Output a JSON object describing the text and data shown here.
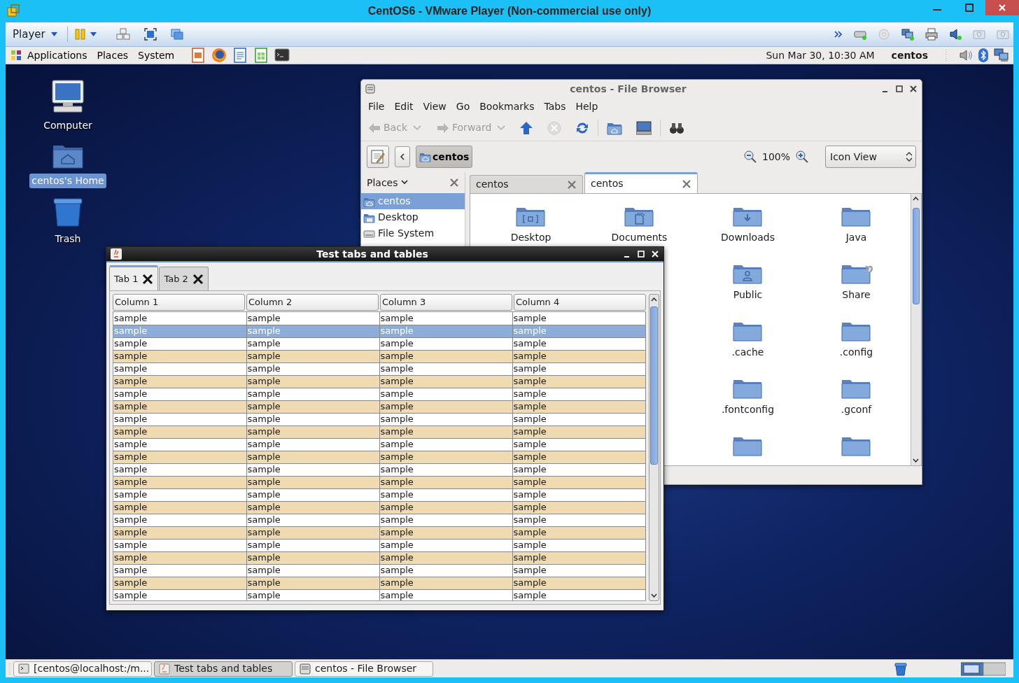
{
  "vm_window": {
    "title": "CentOS6 - VMware Player (Non-commercial use only)"
  },
  "vm_toolbar": {
    "player_menu": "Player"
  },
  "guest_panel": {
    "menus": [
      "Applications",
      "Places",
      "System"
    ],
    "clock": "Sun Mar 30, 10:30 AM",
    "user": "centos"
  },
  "desktop_icons": [
    {
      "label": "Computer",
      "kind": "computer",
      "selected": false
    },
    {
      "label": "centos's Home",
      "kind": "home",
      "selected": true
    },
    {
      "label": "Trash",
      "kind": "trash",
      "selected": false
    }
  ],
  "file_browser": {
    "title": "centos - File Browser",
    "menus": [
      "File",
      "Edit",
      "View",
      "Go",
      "Bookmarks",
      "Tabs",
      "Help"
    ],
    "nav_buttons": [
      {
        "label": "Back",
        "kind": "back",
        "disabled": true
      },
      {
        "label": "Forward",
        "kind": "forward",
        "disabled": true
      }
    ],
    "path_button": "centos",
    "zoom": "100%",
    "view": "Icon View",
    "side_pane": {
      "title": "Places",
      "items": [
        {
          "label": "centos",
          "kind": "home",
          "selected": true
        },
        {
          "label": "Desktop",
          "kind": "desktop",
          "selected": false
        },
        {
          "label": "File System",
          "kind": "drive",
          "selected": false
        }
      ]
    },
    "tabs": [
      {
        "label": "centos",
        "selected": false
      },
      {
        "label": "centos",
        "selected": true
      }
    ],
    "icon_rows": [
      [
        {
          "label": "Desktop",
          "kind": "desktop"
        },
        {
          "label": "Documents",
          "kind": "documents"
        },
        {
          "label": "Downloads",
          "kind": "downloads"
        },
        {
          "label": "Java",
          "kind": "folder"
        }
      ],
      [
        {
          "label": "Public",
          "kind": "public"
        },
        {
          "label": "Share",
          "kind": "link"
        }
      ],
      [
        {
          "label": ".cache",
          "kind": "folder"
        },
        {
          "label": ".config",
          "kind": "folder"
        }
      ],
      [
        {
          "label": ".fontconfig",
          "kind": "folder"
        },
        {
          "label": ".gconf",
          "kind": "folder"
        }
      ],
      [
        {
          "kind": "folder"
        },
        {
          "kind": "folder"
        }
      ]
    ]
  },
  "test_window": {
    "title": "Test tabs and tables",
    "tabs": [
      {
        "label": "Tab 1",
        "selected": true
      },
      {
        "label": "Tab 2",
        "selected": false
      }
    ],
    "table": {
      "columns": [
        "Column 1",
        "Column 2",
        "Column 3",
        "Column 4"
      ],
      "rows": [
        {
          "cells": [
            "sample",
            "sample",
            "sample",
            "sample"
          ],
          "selected": false
        },
        {
          "cells": [
            "sample",
            "sample",
            "sample",
            "sample"
          ],
          "selected": true
        },
        {
          "cells": [
            "sample",
            "sample",
            "sample",
            "sample"
          ],
          "selected": false
        },
        {
          "cells": [
            "sample",
            "sample",
            "sample",
            "sample"
          ],
          "selected": false
        },
        {
          "cells": [
            "sample",
            "sample",
            "sample",
            "sample"
          ],
          "selected": false
        },
        {
          "cells": [
            "sample",
            "sample",
            "sample",
            "sample"
          ],
          "selected": false
        },
        {
          "cells": [
            "sample",
            "sample",
            "sample",
            "sample"
          ],
          "selected": false
        },
        {
          "cells": [
            "sample",
            "sample",
            "sample",
            "sample"
          ],
          "selected": false
        },
        {
          "cells": [
            "sample",
            "sample",
            "sample",
            "sample"
          ],
          "selected": false
        },
        {
          "cells": [
            "sample",
            "sample",
            "sample",
            "sample"
          ],
          "selected": false
        },
        {
          "cells": [
            "sample",
            "sample",
            "sample",
            "sample"
          ],
          "selected": false
        },
        {
          "cells": [
            "sample",
            "sample",
            "sample",
            "sample"
          ],
          "selected": false
        },
        {
          "cells": [
            "sample",
            "sample",
            "sample",
            "sample"
          ],
          "selected": false
        },
        {
          "cells": [
            "sample",
            "sample",
            "sample",
            "sample"
          ],
          "selected": false
        },
        {
          "cells": [
            "sample",
            "sample",
            "sample",
            "sample"
          ],
          "selected": false
        },
        {
          "cells": [
            "sample",
            "sample",
            "sample",
            "sample"
          ],
          "selected": false
        },
        {
          "cells": [
            "sample",
            "sample",
            "sample",
            "sample"
          ],
          "selected": false
        },
        {
          "cells": [
            "sample",
            "sample",
            "sample",
            "sample"
          ],
          "selected": false
        },
        {
          "cells": [
            "sample",
            "sample",
            "sample",
            "sample"
          ],
          "selected": false
        },
        {
          "cells": [
            "sample",
            "sample",
            "sample",
            "sample"
          ],
          "selected": false
        },
        {
          "cells": [
            "sample",
            "sample",
            "sample",
            "sample"
          ],
          "selected": false
        },
        {
          "cells": [
            "sample",
            "sample",
            "sample",
            "sample"
          ],
          "selected": false
        },
        {
          "cells": [
            "sample",
            "sample",
            "sample",
            "sample"
          ],
          "selected": false
        }
      ]
    }
  },
  "taskbar": [
    {
      "label": "[centos@localhost:/m...",
      "kind": "terminal",
      "selected": false
    },
    {
      "label": "Test tabs and tables",
      "kind": "java",
      "selected": true
    },
    {
      "label": "centos - File Browser",
      "kind": "files",
      "selected": false
    }
  ]
}
